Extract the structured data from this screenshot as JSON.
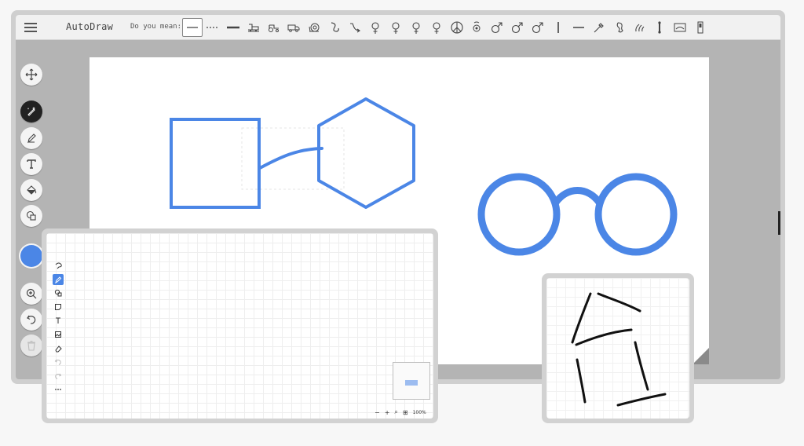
{
  "app": {
    "title": "AutoDraw"
  },
  "suggestions": {
    "label": "Do you mean:",
    "items": [
      "solid-line-icon",
      "dashed-line-icon",
      "thick-line-icon",
      "train-icon",
      "tractor-icon",
      "truck-icon",
      "snail-icon",
      "hook-icon",
      "arrow-curve-icon",
      "female-symbol-icon",
      "female-symbol-icon",
      "female-symbol-icon",
      "female-symbol-icon",
      "peace-icon",
      "female-circle-icon",
      "male-symbol-icon",
      "male-symbol-icon",
      "male-symbol-icon",
      "vertical-line-icon",
      "horizontal-line-icon",
      "brush-icon",
      "seahorse-icon",
      "hand-icon",
      "bone-icon",
      "tray-icon",
      "switch-icon"
    ],
    "selected_index": 0
  },
  "toolbar": {
    "tools": [
      {
        "name": "move-tool",
        "icon": "move-icon"
      },
      {
        "name": "autodraw-tool",
        "icon": "magic-pencil-icon",
        "active": true
      },
      {
        "name": "draw-tool",
        "icon": "pencil-icon"
      },
      {
        "name": "type-tool",
        "icon": "text-icon"
      },
      {
        "name": "fill-tool",
        "icon": "paint-bucket-icon"
      },
      {
        "name": "shape-tool",
        "icon": "shapes-icon"
      }
    ],
    "color": "#4b86e6",
    "bottom_tools": [
      {
        "name": "zoom-tool",
        "icon": "zoom-icon"
      },
      {
        "name": "undo-tool",
        "icon": "undo-icon"
      },
      {
        "name": "delete-tool",
        "icon": "trash-icon",
        "disabled": true
      }
    ]
  },
  "mini_editor": {
    "tools": [
      "lasso-icon",
      "pencil-icon",
      "shapes-icon",
      "sticky-note-icon",
      "text-icon",
      "image-icon",
      "eraser-icon",
      "undo-icon",
      "redo-icon",
      "more-icon"
    ],
    "active_tool": 1,
    "zoom_label": "100%"
  },
  "colors": {
    "stroke": "#4b86e6",
    "accent": "#4b86e6"
  }
}
